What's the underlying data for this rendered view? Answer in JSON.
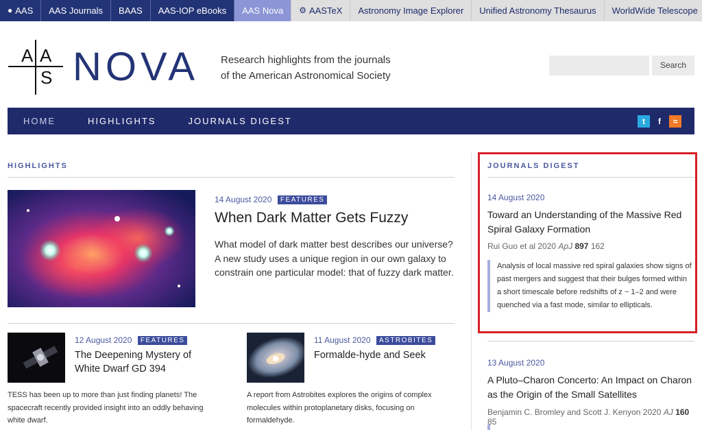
{
  "topbar": {
    "items": [
      {
        "label": "AAS",
        "icon": "globe-icon"
      },
      {
        "label": "AAS Journals"
      },
      {
        "label": "BAAS"
      },
      {
        "label": "AAS-IOP eBooks"
      },
      {
        "label": "AAS Nova",
        "active": true
      },
      {
        "label": "AASTeX",
        "icon": "gear-icon"
      },
      {
        "label": "Astronomy Image Explorer"
      },
      {
        "label": "Unified Astronomy Thesaurus"
      },
      {
        "label": "WorldWide Telescope"
      }
    ]
  },
  "header": {
    "logo_letters": [
      "A",
      "A",
      "S"
    ],
    "brand": "NOVA",
    "tagline_line1": "Research highlights from the journals",
    "tagline_line2": "of the American Astronomical Society",
    "search_placeholder": "",
    "search_label": "Search"
  },
  "nav": {
    "home": "HOME",
    "highlights": "HIGHLIGHTS",
    "digest": "JOURNALS DIGEST",
    "social_icons": [
      "twitter-icon",
      "facebook-icon",
      "rss-icon"
    ]
  },
  "highlights": {
    "section_title": "HIGHLIGHTS",
    "feature": {
      "date": "14 August 2020",
      "badge": "FEATURES",
      "title": "When Dark Matter Gets Fuzzy",
      "text": "What model of dark matter best describes our universe? A new study uses a unique region in our own galaxy to constrain one particular model: that of fuzzy dark matter."
    },
    "cards": [
      {
        "date": "12 August 2020",
        "badge": "FEATURES",
        "title": "The Deepening Mystery of White Dwarf GD 394",
        "text": "TESS has been up to more than just finding planets! The spacecraft recently provided insight into an oddly behaving white dwarf."
      },
      {
        "date": "11 August 2020",
        "badge": "ASTROBITES",
        "title": "Formalde-hyde and Seek",
        "text": "A report from Astrobites explores the origins of complex molecules within protoplanetary disks, focusing on formaldehyde."
      }
    ]
  },
  "digest": {
    "section_title": "JOURNALS DIGEST",
    "entries": [
      {
        "date": "14 August 2020",
        "title": "Toward an Understanding of the Massive Red Spiral Galaxy Formation",
        "authors": "Rui Guo et al 2020",
        "journal": "ApJ",
        "volume": "897",
        "page": "162",
        "abstract": "Analysis of local massive red spiral galaxies show signs of past mergers and suggest that their bulges formed within a short timescale before redshifts of z ~ 1–2 and were quenched via a fast mode, similar to ellipticals."
      },
      {
        "date": "13 August 2020",
        "title": "A Pluto–Charon Concerto: An Impact on Charon as the Origin of the Small Satellites",
        "authors": "Benjamin C. Bromley and Scott J. Kenyon 2020",
        "journal": "AJ",
        "volume": "160",
        "page": "85"
      }
    ]
  },
  "colors": {
    "navy": "#1f2a6b",
    "accent": "#4a57a0",
    "highlight_border": "#d62027",
    "active_tab": "#8c95d6"
  }
}
